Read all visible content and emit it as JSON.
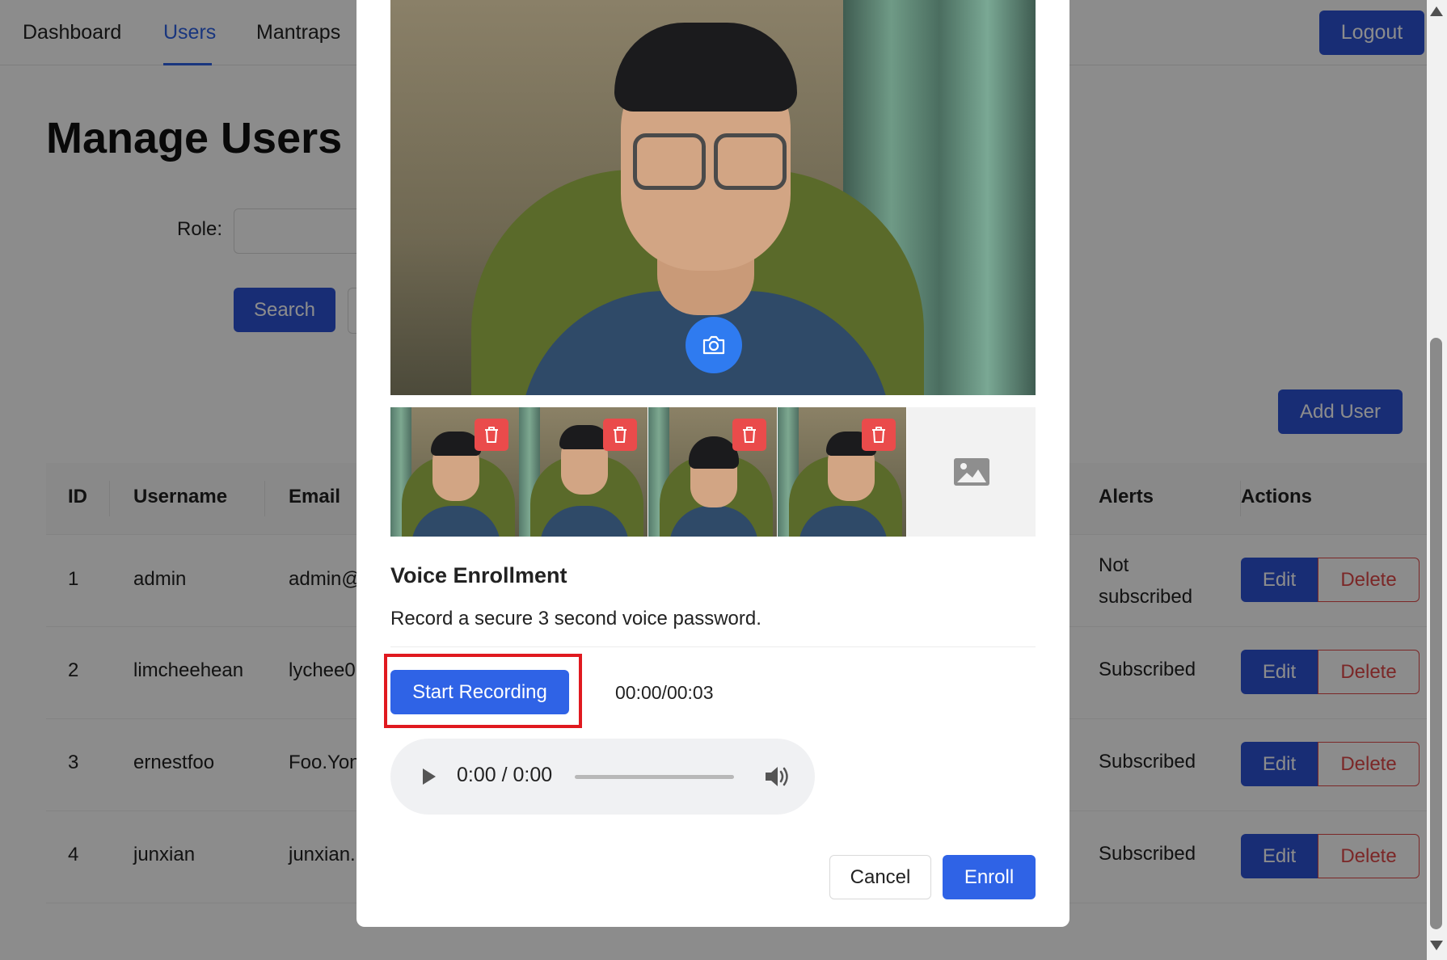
{
  "nav": {
    "items": [
      {
        "label": "Dashboard"
      },
      {
        "label": "Users"
      },
      {
        "label": "Mantraps"
      }
    ],
    "logout_label": "Logout"
  },
  "page": {
    "title": "Manage Users",
    "role_label": "Role:",
    "search_label": "Search",
    "add_user_label": "Add User"
  },
  "table": {
    "headers": {
      "id": "ID",
      "username": "Username",
      "email": "Email",
      "alerts": "Alerts",
      "actions": "Actions"
    },
    "rows": [
      {
        "id": "1",
        "username": "admin",
        "email": "admin@",
        "alerts_line1": "Not",
        "alerts_line2": "subscribed"
      },
      {
        "id": "2",
        "username": "limcheehean",
        "email": "lychee0",
        "alerts_line1": "Subscribed",
        "alerts_line2": ""
      },
      {
        "id": "3",
        "username": "ernestfoo",
        "email": "Foo.Yon",
        "alerts_line1": "Subscribed",
        "alerts_line2": ""
      },
      {
        "id": "4",
        "username": "junxian",
        "email": "junxian.",
        "alerts_line1": "Subscribed",
        "alerts_line2": ""
      }
    ],
    "edit_label": "Edit",
    "delete_label": "Delete"
  },
  "modal": {
    "voice_title": "Voice Enrollment",
    "voice_description": "Record a secure 3 second voice password.",
    "start_recording_label": "Start Recording",
    "timer": "00:00/00:03",
    "audio_time": "0:00 / 0:00",
    "cancel_label": "Cancel",
    "enroll_label": "Enroll",
    "thumbnail_count": 4
  },
  "colors": {
    "primary": "#2c52d6",
    "danger": "#e04848",
    "highlight": "#e0191f",
    "capture": "#2f7bf0"
  }
}
